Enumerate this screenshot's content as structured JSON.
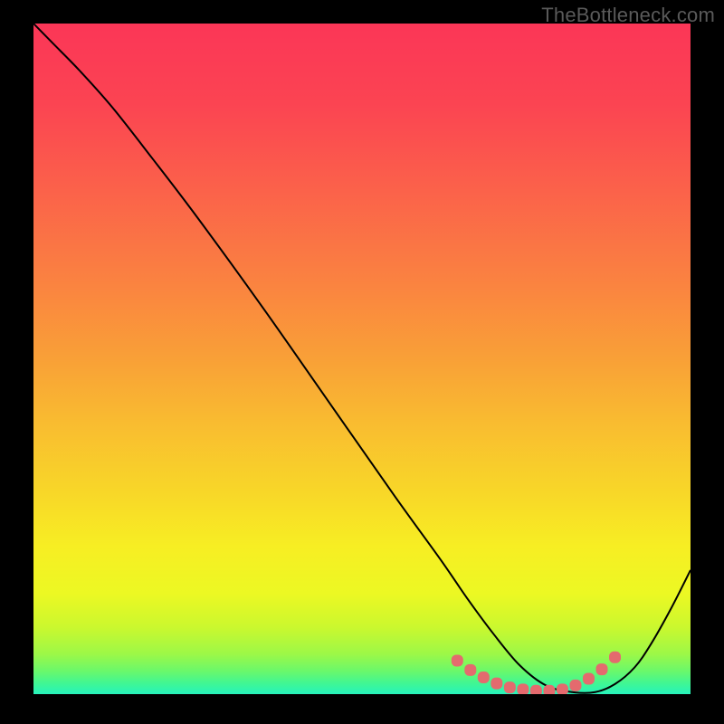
{
  "watermark": "TheBottleneck.com",
  "chart_data": {
    "type": "line",
    "title": "",
    "xlabel": "",
    "ylabel": "",
    "xlim": [
      0,
      100
    ],
    "ylim": [
      0,
      100
    ],
    "grid": false,
    "legend": false,
    "series": [
      {
        "name": "curve",
        "color": "#000000",
        "x": [
          0.0,
          3.0,
          7.0,
          12.0,
          18.0,
          25.0,
          35.0,
          45.0,
          55.0,
          62.0,
          66.0,
          70.0,
          74.0,
          78.0,
          82.0,
          85.5,
          88.5,
          91.5,
          94.0,
          97.0,
          100.0
        ],
        "values": [
          100.0,
          97.0,
          93.0,
          87.5,
          80.0,
          71.0,
          57.5,
          43.5,
          29.5,
          20.0,
          14.3,
          9.0,
          4.3,
          1.3,
          0.3,
          0.3,
          1.5,
          4.0,
          7.5,
          12.7,
          18.5
        ]
      },
      {
        "name": "valley-markers",
        "color": "#e46a6e",
        "marker_shape": "rounded-square",
        "x": [
          64.5,
          66.5,
          68.5,
          70.5,
          72.5,
          74.5,
          76.5,
          78.5,
          80.5,
          82.5,
          84.5,
          86.5,
          88.5
        ],
        "values": [
          5.0,
          3.6,
          2.5,
          1.6,
          1.0,
          0.7,
          0.5,
          0.5,
          0.7,
          1.3,
          2.3,
          3.7,
          5.5
        ]
      }
    ],
    "background_gradient": {
      "stops": [
        {
          "offset": 0.0,
          "color": "#fb3657"
        },
        {
          "offset": 0.12,
          "color": "#fb4452"
        },
        {
          "offset": 0.25,
          "color": "#fb624a"
        },
        {
          "offset": 0.38,
          "color": "#fa8141"
        },
        {
          "offset": 0.5,
          "color": "#f9a037"
        },
        {
          "offset": 0.6,
          "color": "#f9bd30"
        },
        {
          "offset": 0.7,
          "color": "#f8d728"
        },
        {
          "offset": 0.78,
          "color": "#f7ee23"
        },
        {
          "offset": 0.85,
          "color": "#ecf823"
        },
        {
          "offset": 0.9,
          "color": "#cbf82e"
        },
        {
          "offset": 0.94,
          "color": "#9df847"
        },
        {
          "offset": 0.965,
          "color": "#6bf86a"
        },
        {
          "offset": 0.985,
          "color": "#3ef696"
        },
        {
          "offset": 1.0,
          "color": "#27f3bc"
        }
      ]
    }
  }
}
